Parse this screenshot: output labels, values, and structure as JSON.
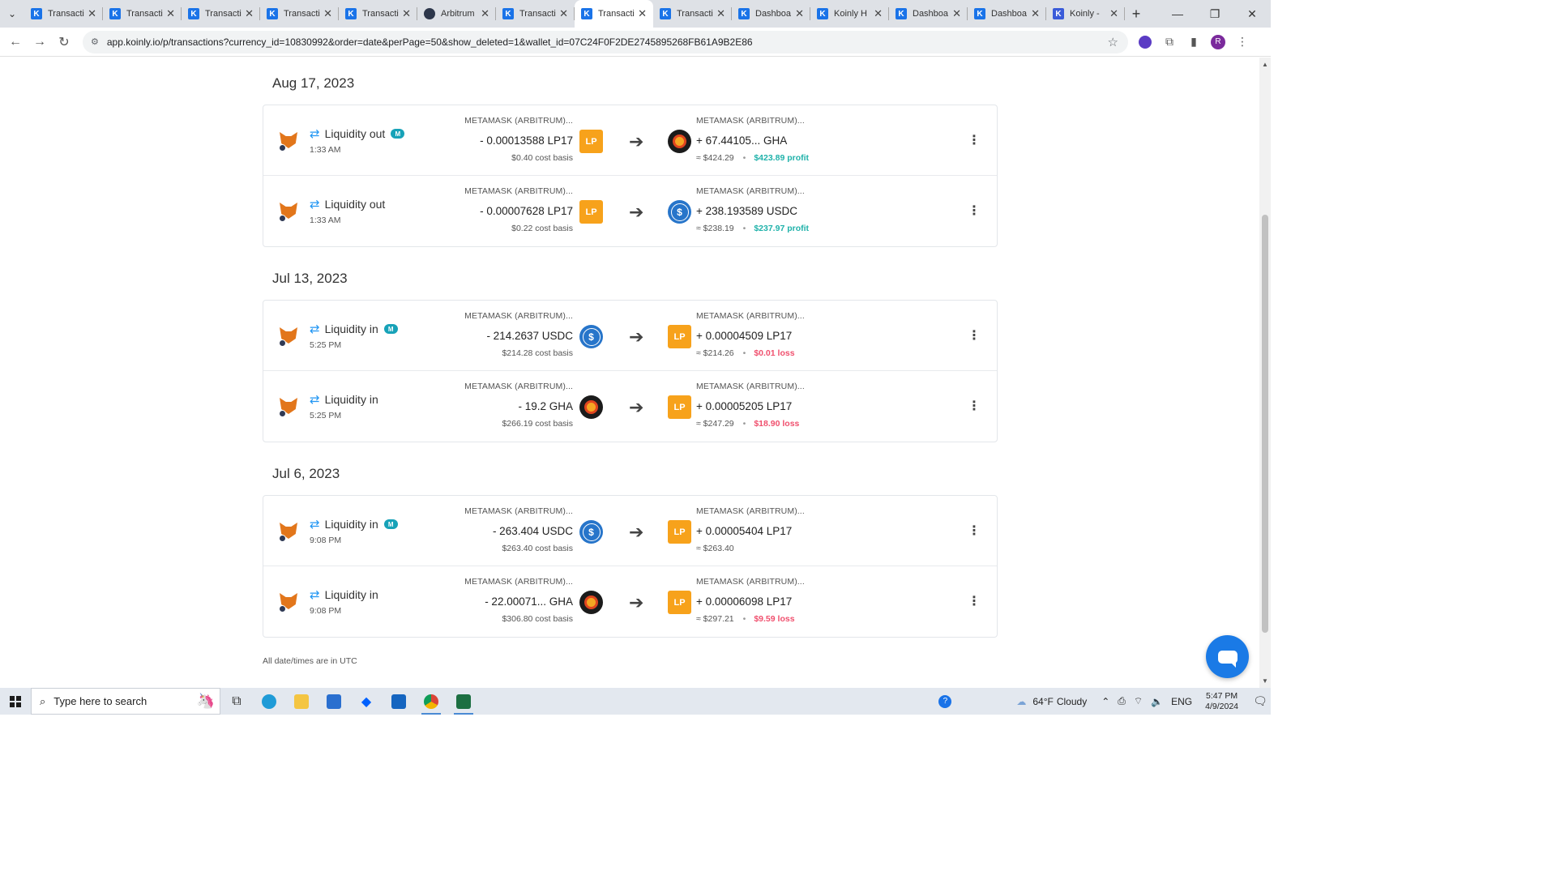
{
  "browser": {
    "tabs": [
      {
        "title": "Transacti",
        "icon": "koinly",
        "active": false
      },
      {
        "title": "Transacti",
        "icon": "koinly",
        "active": false
      },
      {
        "title": "Transacti",
        "icon": "koinly",
        "active": false
      },
      {
        "title": "Transacti",
        "icon": "koinly",
        "active": false
      },
      {
        "title": "Transacti",
        "icon": "koinly",
        "active": false
      },
      {
        "title": "Arbitrum",
        "icon": "arbitrum",
        "active": false
      },
      {
        "title": "Transacti",
        "icon": "koinly",
        "active": false
      },
      {
        "title": "Transacti",
        "icon": "koinly",
        "active": true
      },
      {
        "title": "Transacti",
        "icon": "koinly",
        "active": false
      },
      {
        "title": "Dashboa",
        "icon": "koinly",
        "active": false
      },
      {
        "title": "Koinly H",
        "icon": "koinly",
        "active": false
      },
      {
        "title": "Dashboa",
        "icon": "koinly",
        "active": false
      },
      {
        "title": "Dashboa",
        "icon": "koinly",
        "active": false
      },
      {
        "title": "Koinly - ",
        "icon": "koinly-alt",
        "active": false
      }
    ],
    "url": "app.koinly.io/p/transactions?currency_id=10830992&order=date&perPage=50&show_deleted=1&wallet_id=07C24F0F2DE2745895268FB61A9B2E86",
    "profile_initial": "R"
  },
  "groups": [
    {
      "date": "Aug 17, 2023",
      "rows": [
        {
          "type": "Liquidity out",
          "time": "1:33 AM",
          "manual": true,
          "out_wallet": "METAMASK (ARBITRUM)...",
          "out_amount": "- 0.00013588 LP17",
          "out_sub": "$0.40 cost basis",
          "out_coin": "LP",
          "in_wallet": "METAMASK (ARBITRUM)...",
          "in_amount": "+ 67.44105... GHA",
          "in_value": "≈ $424.29",
          "in_result": "$423.89 profit",
          "in_result_kind": "profit",
          "in_coin": "GHA"
        },
        {
          "type": "Liquidity out",
          "time": "1:33 AM",
          "manual": false,
          "out_wallet": "METAMASK (ARBITRUM)...",
          "out_amount": "- 0.00007628 LP17",
          "out_sub": "$0.22 cost basis",
          "out_coin": "LP",
          "in_wallet": "METAMASK (ARBITRUM)...",
          "in_amount": "+ 238.193589 USDC",
          "in_value": "≈ $238.19",
          "in_result": "$237.97 profit",
          "in_result_kind": "profit",
          "in_coin": "USDC"
        }
      ]
    },
    {
      "date": "Jul 13, 2023",
      "rows": [
        {
          "type": "Liquidity in",
          "time": "5:25 PM",
          "manual": true,
          "out_wallet": "METAMASK (ARBITRUM)...",
          "out_amount": "- 214.2637 USDC",
          "out_sub": "$214.28 cost basis",
          "out_coin": "USDC",
          "in_wallet": "METAMASK (ARBITRUM)...",
          "in_amount": "+ 0.00004509 LP17",
          "in_value": "≈ $214.26",
          "in_result": "$0.01 loss",
          "in_result_kind": "loss",
          "in_coin": "LP"
        },
        {
          "type": "Liquidity in",
          "time": "5:25 PM",
          "manual": false,
          "out_wallet": "METAMASK (ARBITRUM)...",
          "out_amount": "- 19.2 GHA",
          "out_sub": "$266.19 cost basis",
          "out_coin": "GHA",
          "in_wallet": "METAMASK (ARBITRUM)...",
          "in_amount": "+ 0.00005205 LP17",
          "in_value": "≈ $247.29",
          "in_result": "$18.90 loss",
          "in_result_kind": "loss",
          "in_coin": "LP"
        }
      ]
    },
    {
      "date": "Jul 6, 2023",
      "rows": [
        {
          "type": "Liquidity in",
          "time": "9:08 PM",
          "manual": true,
          "out_wallet": "METAMASK (ARBITRUM)...",
          "out_amount": "- 263.404 USDC",
          "out_sub": "$263.40 cost basis",
          "out_coin": "USDC",
          "in_wallet": "METAMASK (ARBITRUM)...",
          "in_amount": "+ 0.00005404 LP17",
          "in_value": "≈ $263.40",
          "in_result": "",
          "in_result_kind": "none",
          "in_coin": "LP"
        },
        {
          "type": "Liquidity in",
          "time": "9:08 PM",
          "manual": false,
          "out_wallet": "METAMASK (ARBITRUM)...",
          "out_amount": "- 22.00071... GHA",
          "out_sub": "$306.80 cost basis",
          "out_coin": "GHA",
          "in_wallet": "METAMASK (ARBITRUM)...",
          "in_amount": "+ 0.00006098 LP17",
          "in_value": "≈ $297.21",
          "in_result": "$9.59 loss",
          "in_result_kind": "loss",
          "in_coin": "LP"
        }
      ]
    }
  ],
  "labels": {
    "manual_badge": "M",
    "lp_coin": "LP",
    "usdc_symbol": "$",
    "utc_note": "All date/times are in UTC"
  },
  "taskbar": {
    "search_placeholder": "Type here to search",
    "temperature": "64°F",
    "weather": "Cloudy",
    "language": "ENG",
    "time": "5:47 PM",
    "date": "4/9/2024"
  },
  "colors": {
    "profit": "#20b2aa",
    "loss": "#f0506e",
    "lp": "#f7a21b",
    "usdc": "#2775ca",
    "swap_icon": "#2196f3",
    "chat": "#1a7ae6"
  }
}
